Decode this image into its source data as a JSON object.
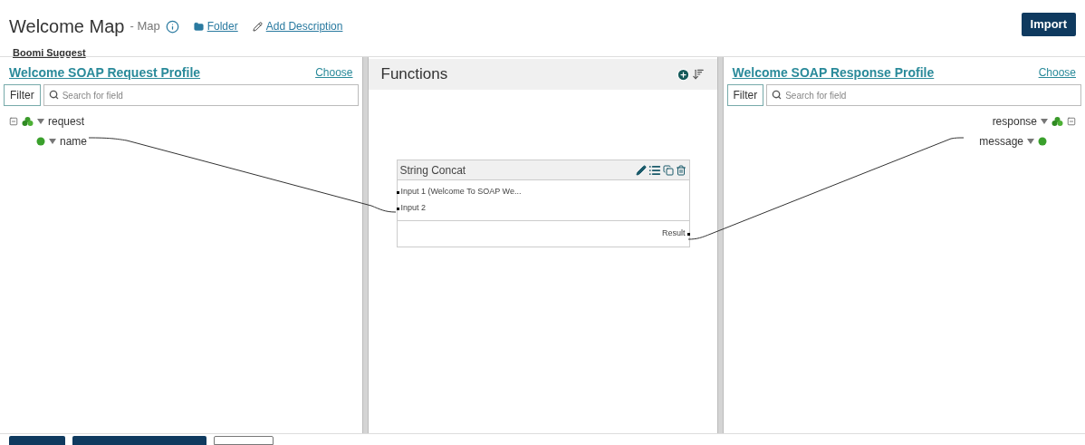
{
  "header": {
    "title": "Welcome Map",
    "subtitle": "- Map",
    "links": [
      {
        "kind": "folder",
        "label": "Folder"
      },
      {
        "kind": "edit",
        "label": "Add Description"
      }
    ],
    "import_button": "Import",
    "suggest_link": "Boomi Suggest"
  },
  "source": {
    "title": "Welcome SOAP Request Profile",
    "choose": "Choose",
    "filter": "Filter",
    "placeholder": "Search for field",
    "tree": [
      {
        "label": "request",
        "children": [
          {
            "label": "name"
          }
        ]
      }
    ]
  },
  "functions": {
    "title": "Functions",
    "node": {
      "title": "String Concat",
      "inputs": [
        "Input 1 (Welcome To SOAP We...",
        "Input 2"
      ],
      "output": "Result"
    }
  },
  "target": {
    "title": "Welcome SOAP Response Profile",
    "choose": "Choose",
    "filter": "Filter",
    "placeholder": "Search for field",
    "tree": [
      {
        "label": "response",
        "children": [
          {
            "label": "message"
          }
        ]
      }
    ]
  }
}
